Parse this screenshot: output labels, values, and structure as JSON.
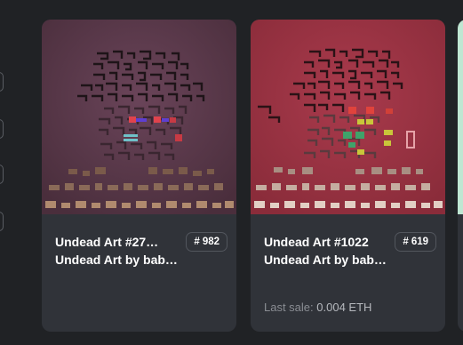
{
  "cards": [
    {
      "name": "Undead Art #27…",
      "rank_prefix": "#",
      "rank": "982",
      "collection": "Undead Art by bab…",
      "last_sale_label": "",
      "last_sale_value": "",
      "bg": "#5b3a4a",
      "art_image": "undead-pixel-art-dark"
    },
    {
      "name": "Undead Art #1022",
      "rank_prefix": "#",
      "rank": "619",
      "collection": "Undead Art by bab…",
      "last_sale_label": "Last sale: ",
      "last_sale_value": "0.004 ETH",
      "bg": "#9a3343",
      "art_image": "undead-pixel-art-red"
    }
  ],
  "colors": {
    "page_bg": "#202225",
    "card_bg": "#303339",
    "badge_border": "#52565d",
    "muted_text": "#8a8d93"
  }
}
